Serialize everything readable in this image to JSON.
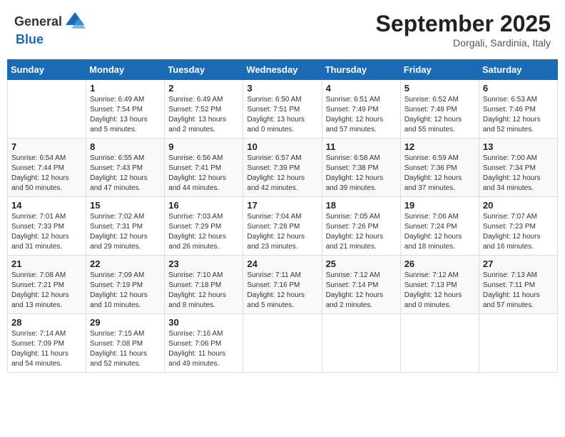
{
  "header": {
    "logo_general": "General",
    "logo_blue": "Blue",
    "month": "September 2025",
    "location": "Dorgali, Sardinia, Italy"
  },
  "weekdays": [
    "Sunday",
    "Monday",
    "Tuesday",
    "Wednesday",
    "Thursday",
    "Friday",
    "Saturday"
  ],
  "weeks": [
    [
      {
        "day": "",
        "info": ""
      },
      {
        "day": "1",
        "info": "Sunrise: 6:49 AM\nSunset: 7:54 PM\nDaylight: 13 hours\nand 5 minutes."
      },
      {
        "day": "2",
        "info": "Sunrise: 6:49 AM\nSunset: 7:52 PM\nDaylight: 13 hours\nand 2 minutes."
      },
      {
        "day": "3",
        "info": "Sunrise: 6:50 AM\nSunset: 7:51 PM\nDaylight: 13 hours\nand 0 minutes."
      },
      {
        "day": "4",
        "info": "Sunrise: 6:51 AM\nSunset: 7:49 PM\nDaylight: 12 hours\nand 57 minutes."
      },
      {
        "day": "5",
        "info": "Sunrise: 6:52 AM\nSunset: 7:48 PM\nDaylight: 12 hours\nand 55 minutes."
      },
      {
        "day": "6",
        "info": "Sunrise: 6:53 AM\nSunset: 7:46 PM\nDaylight: 12 hours\nand 52 minutes."
      }
    ],
    [
      {
        "day": "7",
        "info": "Sunrise: 6:54 AM\nSunset: 7:44 PM\nDaylight: 12 hours\nand 50 minutes."
      },
      {
        "day": "8",
        "info": "Sunrise: 6:55 AM\nSunset: 7:43 PM\nDaylight: 12 hours\nand 47 minutes."
      },
      {
        "day": "9",
        "info": "Sunrise: 6:56 AM\nSunset: 7:41 PM\nDaylight: 12 hours\nand 44 minutes."
      },
      {
        "day": "10",
        "info": "Sunrise: 6:57 AM\nSunset: 7:39 PM\nDaylight: 12 hours\nand 42 minutes."
      },
      {
        "day": "11",
        "info": "Sunrise: 6:58 AM\nSunset: 7:38 PM\nDaylight: 12 hours\nand 39 minutes."
      },
      {
        "day": "12",
        "info": "Sunrise: 6:59 AM\nSunset: 7:36 PM\nDaylight: 12 hours\nand 37 minutes."
      },
      {
        "day": "13",
        "info": "Sunrise: 7:00 AM\nSunset: 7:34 PM\nDaylight: 12 hours\nand 34 minutes."
      }
    ],
    [
      {
        "day": "14",
        "info": "Sunrise: 7:01 AM\nSunset: 7:33 PM\nDaylight: 12 hours\nand 31 minutes."
      },
      {
        "day": "15",
        "info": "Sunrise: 7:02 AM\nSunset: 7:31 PM\nDaylight: 12 hours\nand 29 minutes."
      },
      {
        "day": "16",
        "info": "Sunrise: 7:03 AM\nSunset: 7:29 PM\nDaylight: 12 hours\nand 26 minutes."
      },
      {
        "day": "17",
        "info": "Sunrise: 7:04 AM\nSunset: 7:28 PM\nDaylight: 12 hours\nand 23 minutes."
      },
      {
        "day": "18",
        "info": "Sunrise: 7:05 AM\nSunset: 7:26 PM\nDaylight: 12 hours\nand 21 minutes."
      },
      {
        "day": "19",
        "info": "Sunrise: 7:06 AM\nSunset: 7:24 PM\nDaylight: 12 hours\nand 18 minutes."
      },
      {
        "day": "20",
        "info": "Sunrise: 7:07 AM\nSunset: 7:23 PM\nDaylight: 12 hours\nand 16 minutes."
      }
    ],
    [
      {
        "day": "21",
        "info": "Sunrise: 7:08 AM\nSunset: 7:21 PM\nDaylight: 12 hours\nand 13 minutes."
      },
      {
        "day": "22",
        "info": "Sunrise: 7:09 AM\nSunset: 7:19 PM\nDaylight: 12 hours\nand 10 minutes."
      },
      {
        "day": "23",
        "info": "Sunrise: 7:10 AM\nSunset: 7:18 PM\nDaylight: 12 hours\nand 8 minutes."
      },
      {
        "day": "24",
        "info": "Sunrise: 7:11 AM\nSunset: 7:16 PM\nDaylight: 12 hours\nand 5 minutes."
      },
      {
        "day": "25",
        "info": "Sunrise: 7:12 AM\nSunset: 7:14 PM\nDaylight: 12 hours\nand 2 minutes."
      },
      {
        "day": "26",
        "info": "Sunrise: 7:12 AM\nSunset: 7:13 PM\nDaylight: 12 hours\nand 0 minutes."
      },
      {
        "day": "27",
        "info": "Sunrise: 7:13 AM\nSunset: 7:11 PM\nDaylight: 11 hours\nand 57 minutes."
      }
    ],
    [
      {
        "day": "28",
        "info": "Sunrise: 7:14 AM\nSunset: 7:09 PM\nDaylight: 11 hours\nand 54 minutes."
      },
      {
        "day": "29",
        "info": "Sunrise: 7:15 AM\nSunset: 7:08 PM\nDaylight: 11 hours\nand 52 minutes."
      },
      {
        "day": "30",
        "info": "Sunrise: 7:16 AM\nSunset: 7:06 PM\nDaylight: 11 hours\nand 49 minutes."
      },
      {
        "day": "",
        "info": ""
      },
      {
        "day": "",
        "info": ""
      },
      {
        "day": "",
        "info": ""
      },
      {
        "day": "",
        "info": ""
      }
    ]
  ]
}
